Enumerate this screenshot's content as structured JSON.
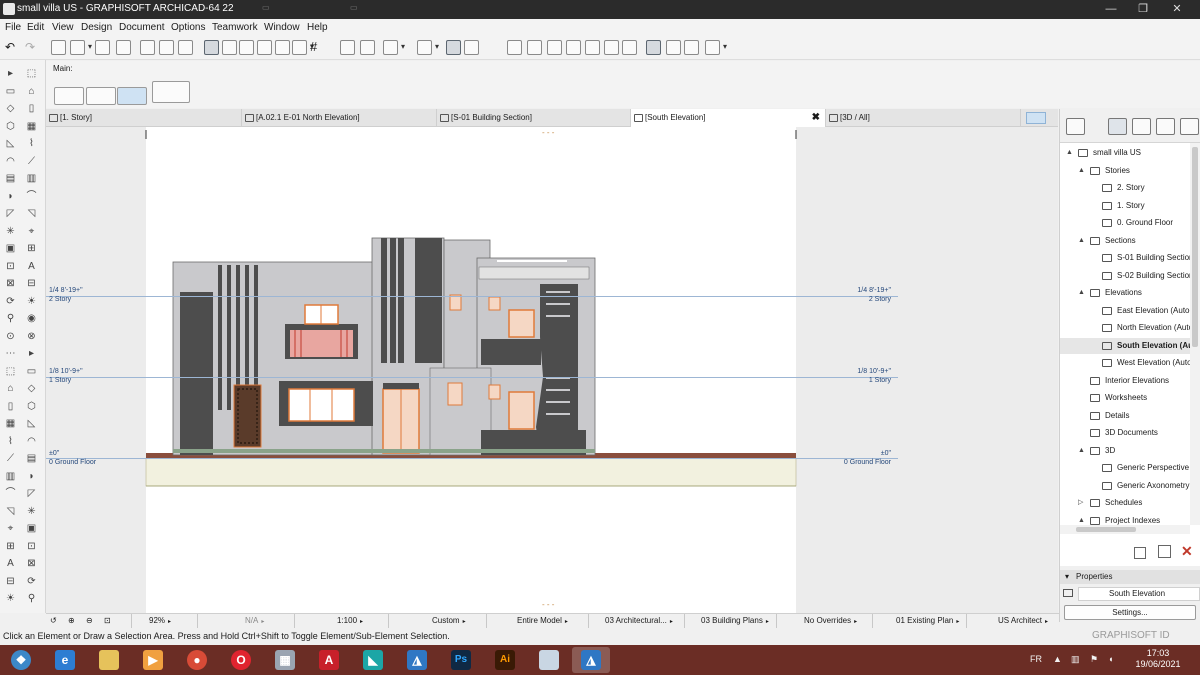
{
  "window": {
    "title": "small villa US - GRAPHISOFT ARCHICAD-64 22",
    "minimize_glyph": "—",
    "maximize_glyph": "❐",
    "close_glyph": "✕"
  },
  "menu": [
    "File",
    "Edit",
    "View",
    "Design",
    "Document",
    "Options",
    "Teamwork",
    "Window",
    "Help"
  ],
  "info_box": {
    "label": "Main:"
  },
  "tabs": [
    {
      "label": "[1. Story]",
      "active": false
    },
    {
      "label": "[A.02.1 E-01 North Elevation]",
      "active": false
    },
    {
      "label": "[S-01 Building Section]",
      "active": false
    },
    {
      "label": "[South Elevation]",
      "active": true,
      "close": "✖"
    },
    {
      "label": "[3D / All]",
      "active": false
    }
  ],
  "levels": [
    {
      "value": "1/4  8'-19+\"",
      "name": "2 Story"
    },
    {
      "value": "1/8  10'-9+\"",
      "name": "1 Story"
    },
    {
      "value": "±0\"",
      "name": "0 Ground Floor"
    }
  ],
  "navigator": {
    "tree": [
      {
        "label": "small villa US",
        "depth": 0,
        "expand": "▲",
        "icon": "project-icon"
      },
      {
        "label": "Stories",
        "depth": 1,
        "expand": "▲",
        "icon": "folder-icon"
      },
      {
        "label": "2. Story",
        "depth": 2,
        "expand": "",
        "icon": "story-icon"
      },
      {
        "label": "1. Story",
        "depth": 2,
        "expand": "",
        "icon": "story-icon"
      },
      {
        "label": "0. Ground Floor",
        "depth": 2,
        "expand": "",
        "icon": "story-icon"
      },
      {
        "label": "Sections",
        "depth": 1,
        "expand": "▲",
        "icon": "folder-icon"
      },
      {
        "label": "S-01 Building Section",
        "depth": 2,
        "expand": "",
        "icon": "section-icon"
      },
      {
        "label": "S-02 Building Section",
        "depth": 2,
        "expand": "",
        "icon": "section-icon"
      },
      {
        "label": "Elevations",
        "depth": 1,
        "expand": "▲",
        "icon": "folder-icon"
      },
      {
        "label": "East Elevation (Auto-r",
        "depth": 2,
        "expand": "",
        "icon": "elevation-icon"
      },
      {
        "label": "North Elevation (Auto",
        "depth": 2,
        "expand": "",
        "icon": "elevation-icon"
      },
      {
        "label": "South Elevation (Au",
        "depth": 2,
        "expand": "",
        "icon": "elevation-icon",
        "selected": true
      },
      {
        "label": "West Elevation (Auto-",
        "depth": 2,
        "expand": "",
        "icon": "elevation-icon"
      },
      {
        "label": "Interior Elevations",
        "depth": 1,
        "expand": "",
        "icon": "interior-elevation-icon"
      },
      {
        "label": "Worksheets",
        "depth": 1,
        "expand": "",
        "icon": "worksheet-icon"
      },
      {
        "label": "Details",
        "depth": 1,
        "expand": "",
        "icon": "detail-icon"
      },
      {
        "label": "3D Documents",
        "depth": 1,
        "expand": "",
        "icon": "3d-document-icon"
      },
      {
        "label": "3D",
        "depth": 1,
        "expand": "▲",
        "icon": "3d-icon"
      },
      {
        "label": "Generic Perspective",
        "depth": 2,
        "expand": "",
        "icon": "perspective-icon"
      },
      {
        "label": "Generic Axonometry",
        "depth": 2,
        "expand": "",
        "icon": "axonometry-icon"
      },
      {
        "label": "Schedules",
        "depth": 1,
        "expand": "▷",
        "icon": "schedule-icon"
      },
      {
        "label": "Project Indexes",
        "depth": 1,
        "expand": "▲",
        "icon": "index-icon"
      }
    ]
  },
  "properties": {
    "header": "Properties",
    "value": "South Elevation",
    "settings_button": "Settings..."
  },
  "quick_options": {
    "zoom": "92%",
    "angle": "N/A",
    "scale": "1:100",
    "layer_combo": "Custom",
    "model_filter": "Entire Model",
    "pen_set": "03 Architectural...",
    "model_view": "03 Building Plans",
    "graphic_override": "No Overrides",
    "renovation": "01 Existing Plan",
    "dimension": "US Architect"
  },
  "status": {
    "message": "Click an Element or Draw a Selection Area. Press and Hold Ctrl+Shift to Toggle Element/Sub-Element Selection.",
    "brand": "GRAPHISOFT ID"
  },
  "taskbar": {
    "language": "FR",
    "time": "17:03",
    "date": "19/06/2021",
    "apps": [
      "start",
      "internet-explorer",
      "file-explorer",
      "media-player",
      "chrome",
      "opera",
      "calculator",
      "autocad",
      "autodesk",
      "archicad",
      "photoshop",
      "illustrator",
      "paint",
      "archicad-active"
    ]
  },
  "colors": {
    "accent_orange": "#e07a3a",
    "facade_grey": "#c9c9cc",
    "dark_grey": "#4d4d4d",
    "level_line": "#9db6d4",
    "taskbar": "#6b2d25"
  }
}
